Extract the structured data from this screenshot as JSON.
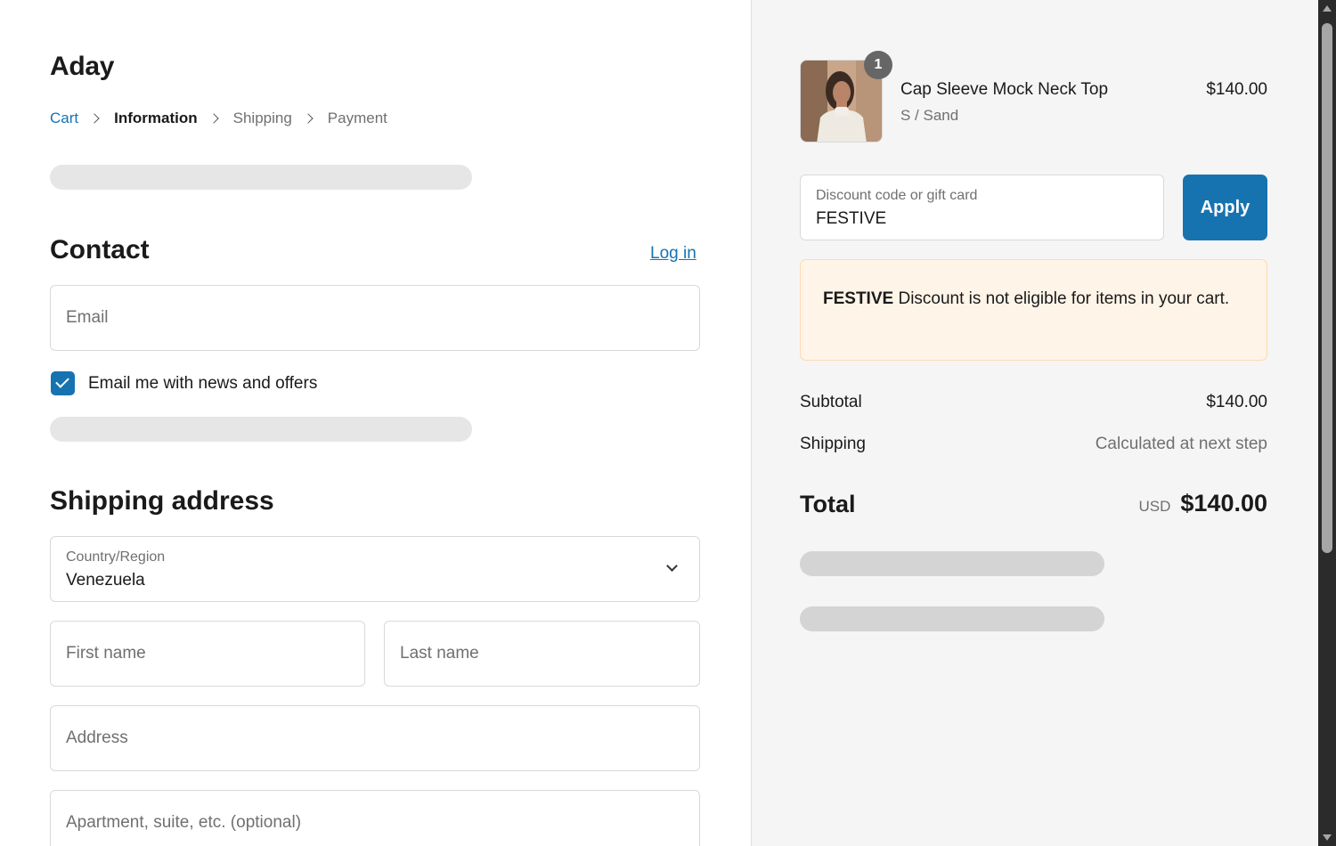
{
  "shop": {
    "name": "Aday"
  },
  "breadcrumb": [
    {
      "label": "Cart"
    },
    {
      "label": "Information"
    },
    {
      "label": "Shipping"
    },
    {
      "label": "Payment"
    }
  ],
  "contact": {
    "title": "Contact",
    "login_label": "Log in",
    "email_placeholder": "Email",
    "newsletter_label": "Email me with news and offers",
    "newsletter_checked": true
  },
  "shipping": {
    "title": "Shipping address",
    "country_label": "Country/Region",
    "country_value": "Venezuela",
    "first_name_placeholder": "First name",
    "last_name_placeholder": "Last name",
    "address_placeholder": "Address",
    "apartment_placeholder": "Apartment, suite, etc. (optional)"
  },
  "order": {
    "product": {
      "name": "Cap Sleeve Mock Neck Top",
      "variant": "S / Sand",
      "price": "$140.00",
      "quantity": "1"
    },
    "discount": {
      "label": "Discount code or gift card",
      "value": "FESTIVE",
      "apply_label": "Apply"
    },
    "notice": {
      "code": "FESTIVE",
      "message": "Discount is not eligible for items in your cart."
    },
    "subtotal_label": "Subtotal",
    "subtotal_value": "$140.00",
    "shipping_label": "Shipping",
    "shipping_value": "Calculated at next step",
    "total_label": "Total",
    "currency": "USD",
    "total_value": "$140.00"
  },
  "colors": {
    "accent": "#1773b0",
    "notice_bg": "#fff4e8",
    "sidebar_bg": "#f5f5f5"
  }
}
